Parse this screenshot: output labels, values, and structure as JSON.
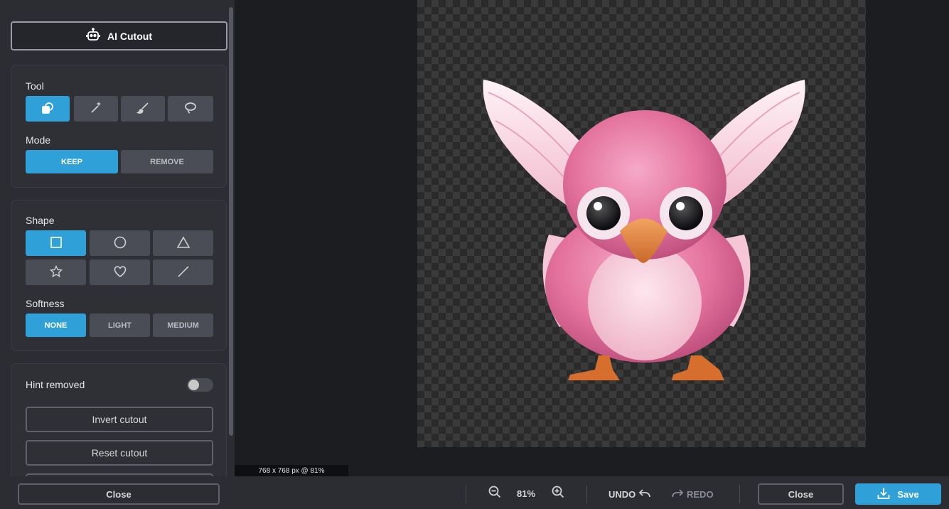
{
  "sidebar": {
    "ai_cutout_label": "AI Cutout",
    "tool": {
      "label": "Tool",
      "tools": [
        "shape-tool-icon",
        "magic-wand-icon",
        "brush-icon",
        "lasso-icon"
      ],
      "active": "shape-tool-icon"
    },
    "mode": {
      "label": "Mode",
      "options": [
        "KEEP",
        "REMOVE"
      ],
      "active": "KEEP"
    },
    "shape": {
      "label": "Shape",
      "shapes": [
        "square-icon",
        "circle-icon",
        "triangle-icon",
        "star-icon",
        "heart-icon",
        "line-icon"
      ],
      "active": "square-icon"
    },
    "softness": {
      "label": "Softness",
      "options": [
        "NONE",
        "LIGHT",
        "MEDIUM"
      ],
      "active": "NONE"
    },
    "hint_removed": {
      "label": "Hint removed",
      "enabled": false
    },
    "invert_cutout": "Invert cutout",
    "reset_cutout": "Reset cutout"
  },
  "canvas": {
    "size_info": "768 x 768 px @ 81%",
    "image_subject": "pink cartoon bird with wings"
  },
  "bottombar": {
    "close_left": "Close",
    "zoom": "81%",
    "undo": "UNDO",
    "redo": "REDO",
    "close_right": "Close",
    "save": "Save"
  },
  "colors": {
    "accent": "#2fa0d8",
    "sidebar_bg": "#2b2d33",
    "canvas_bg": "#1c1d21"
  }
}
